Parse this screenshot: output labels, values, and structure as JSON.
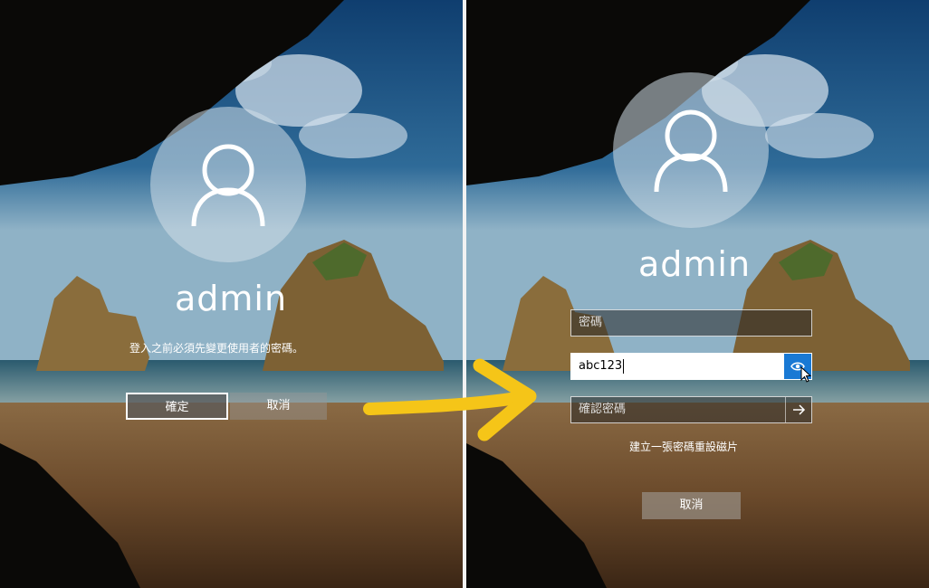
{
  "left": {
    "username": "admin",
    "message": "登入之前必須先變更使用者的密碼。",
    "ok_label": "確定",
    "cancel_label": "取消"
  },
  "right": {
    "username": "admin",
    "password_placeholder": "密碼",
    "new_password_value": "abc123",
    "confirm_placeholder": "確認密碼",
    "reset_disk_link": "建立一張密碼重設磁片",
    "cancel_label": "取消"
  },
  "colors": {
    "accent_blue": "#1979d4",
    "arrow_yellow": "#f5c518"
  }
}
